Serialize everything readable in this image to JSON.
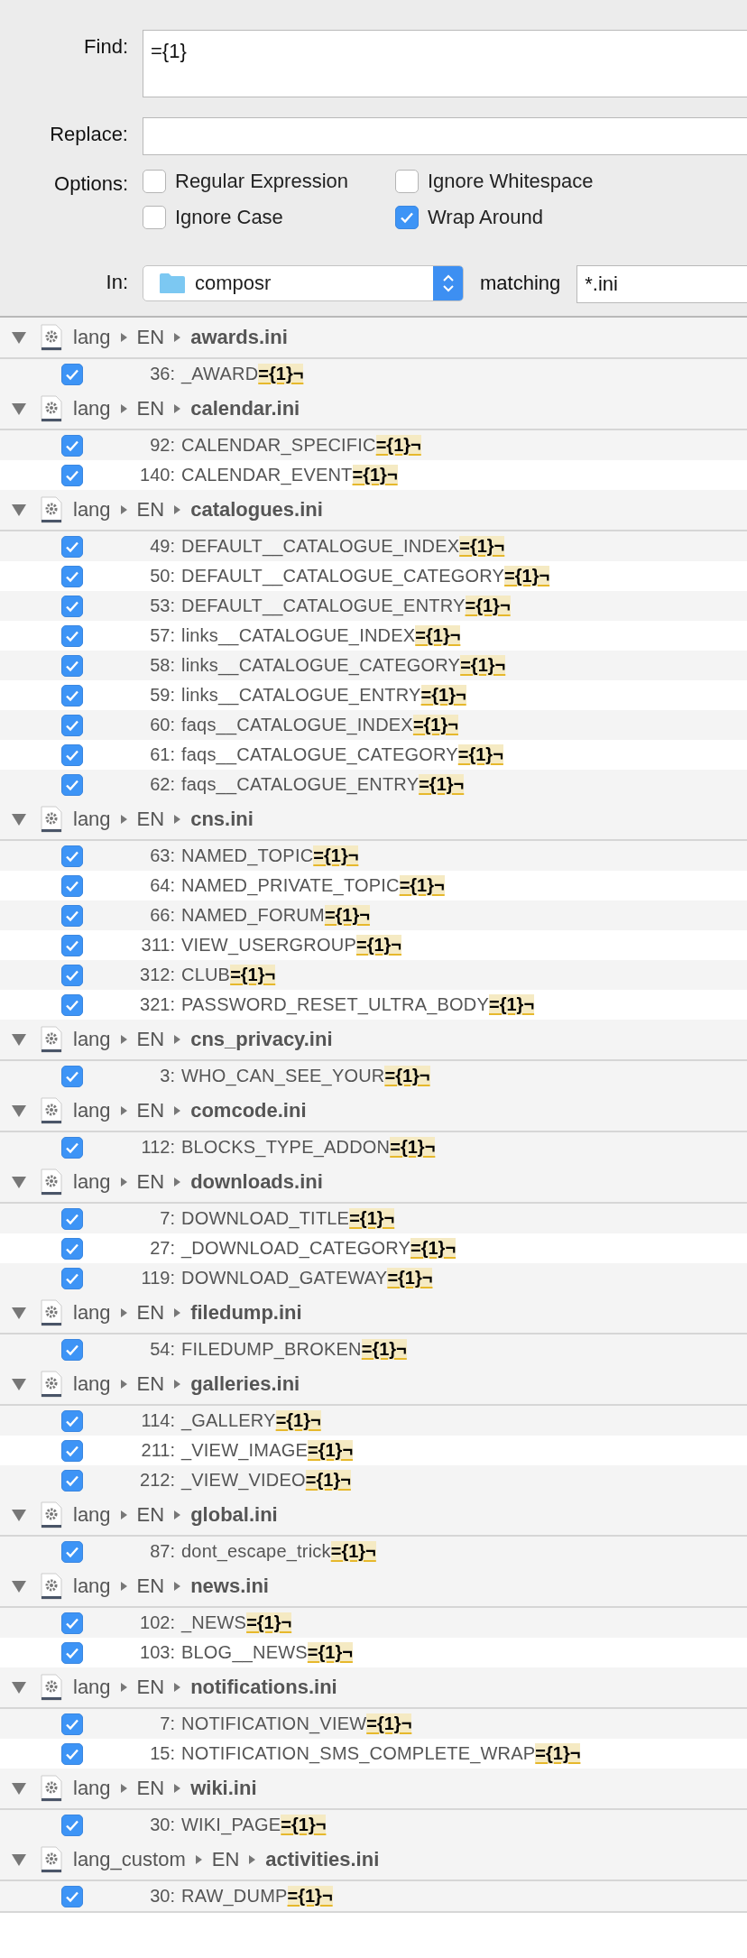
{
  "find": {
    "label": "Find:",
    "value": "={1}"
  },
  "replace": {
    "label": "Replace:"
  },
  "options": {
    "label": "Options:",
    "items": [
      {
        "label": "Regular Expression",
        "checked": false
      },
      {
        "label": "Ignore Whitespace",
        "checked": false
      },
      {
        "label": "Ignore Case",
        "checked": false
      },
      {
        "label": "Wrap Around",
        "checked": true
      }
    ]
  },
  "scope": {
    "label": "In:",
    "folder": "composr",
    "matching_label": "matching",
    "matching": "*.ini"
  },
  "results": [
    {
      "path": [
        "lang",
        "EN"
      ],
      "file": "awards.ini",
      "expanded": true,
      "matches": [
        {
          "line": "36:",
          "text": "_AWARD",
          "match": "={1}¬",
          "checked": true
        }
      ]
    },
    {
      "path": [
        "lang",
        "EN"
      ],
      "file": "calendar.ini",
      "expanded": true,
      "matches": [
        {
          "line": "92:",
          "text": "CALENDAR_SPECIFIC",
          "match": "={1}¬",
          "checked": true
        },
        {
          "line": "140:",
          "text": "CALENDAR_EVENT",
          "match": "={1}¬",
          "checked": true
        }
      ]
    },
    {
      "path": [
        "lang",
        "EN"
      ],
      "file": "catalogues.ini",
      "expanded": true,
      "matches": [
        {
          "line": "49:",
          "text": "DEFAULT__CATALOGUE_INDEX",
          "match": "={1}¬",
          "checked": true
        },
        {
          "line": "50:",
          "text": "DEFAULT__CATALOGUE_CATEGORY",
          "match": "={1}¬",
          "checked": true
        },
        {
          "line": "53:",
          "text": "DEFAULT__CATALOGUE_ENTRY",
          "match": "={1}¬",
          "checked": true
        },
        {
          "line": "57:",
          "text": "links__CATALOGUE_INDEX",
          "match": "={1}¬",
          "checked": true
        },
        {
          "line": "58:",
          "text": "links__CATALOGUE_CATEGORY",
          "match": "={1}¬",
          "checked": true
        },
        {
          "line": "59:",
          "text": "links__CATALOGUE_ENTRY",
          "match": "={1}¬",
          "checked": true
        },
        {
          "line": "60:",
          "text": "faqs__CATALOGUE_INDEX",
          "match": "={1}¬",
          "checked": true
        },
        {
          "line": "61:",
          "text": "faqs__CATALOGUE_CATEGORY",
          "match": "={1}¬",
          "checked": true
        },
        {
          "line": "62:",
          "text": "faqs__CATALOGUE_ENTRY",
          "match": "={1}¬",
          "checked": true
        }
      ]
    },
    {
      "path": [
        "lang",
        "EN"
      ],
      "file": "cns.ini",
      "expanded": true,
      "matches": [
        {
          "line": "63:",
          "text": "NAMED_TOPIC",
          "match": "={1}¬",
          "checked": true
        },
        {
          "line": "64:",
          "text": "NAMED_PRIVATE_TOPIC",
          "match": "={1}¬",
          "checked": true
        },
        {
          "line": "66:",
          "text": "NAMED_FORUM",
          "match": "={1}¬",
          "checked": true
        },
        {
          "line": "311:",
          "text": "VIEW_USERGROUP",
          "match": "={1}¬",
          "checked": true
        },
        {
          "line": "312:",
          "text": "CLUB",
          "match": "={1}¬",
          "checked": true
        },
        {
          "line": "321:",
          "text": "PASSWORD_RESET_ULTRA_BODY",
          "match": "={1}¬",
          "checked": true
        }
      ]
    },
    {
      "path": [
        "lang",
        "EN"
      ],
      "file": "cns_privacy.ini",
      "expanded": true,
      "matches": [
        {
          "line": "3:",
          "text": "WHO_CAN_SEE_YOUR",
          "match": "={1}¬",
          "checked": true
        }
      ]
    },
    {
      "path": [
        "lang",
        "EN"
      ],
      "file": "comcode.ini",
      "expanded": true,
      "matches": [
        {
          "line": "112:",
          "text": "BLOCKS_TYPE_ADDON",
          "match": "={1}¬",
          "checked": true
        }
      ]
    },
    {
      "path": [
        "lang",
        "EN"
      ],
      "file": "downloads.ini",
      "expanded": true,
      "matches": [
        {
          "line": "7:",
          "text": "DOWNLOAD_TITLE",
          "match": "={1}¬",
          "checked": true
        },
        {
          "line": "27:",
          "text": "_DOWNLOAD_CATEGORY",
          "match": "={1}¬",
          "checked": true
        },
        {
          "line": "119:",
          "text": "DOWNLOAD_GATEWAY",
          "match": "={1}¬",
          "checked": true
        }
      ]
    },
    {
      "path": [
        "lang",
        "EN"
      ],
      "file": "filedump.ini",
      "expanded": true,
      "matches": [
        {
          "line": "54:",
          "text": "FILEDUMP_BROKEN",
          "match": "={1}¬",
          "checked": true
        }
      ]
    },
    {
      "path": [
        "lang",
        "EN"
      ],
      "file": "galleries.ini",
      "expanded": true,
      "matches": [
        {
          "line": "114:",
          "text": "_GALLERY",
          "match": "={1}¬",
          "checked": true
        },
        {
          "line": "211:",
          "text": "_VIEW_IMAGE",
          "match": "={1}¬",
          "checked": true
        },
        {
          "line": "212:",
          "text": "_VIEW_VIDEO",
          "match": "={1}¬",
          "checked": true
        }
      ]
    },
    {
      "path": [
        "lang",
        "EN"
      ],
      "file": "global.ini",
      "expanded": true,
      "matches": [
        {
          "line": "87:",
          "text": "dont_escape_trick",
          "match": "={1}¬",
          "checked": true
        }
      ]
    },
    {
      "path": [
        "lang",
        "EN"
      ],
      "file": "news.ini",
      "expanded": true,
      "matches": [
        {
          "line": "102:",
          "text": "_NEWS",
          "match": "={1}¬",
          "checked": true
        },
        {
          "line": "103:",
          "text": "BLOG__NEWS",
          "match": "={1}¬",
          "checked": true
        }
      ]
    },
    {
      "path": [
        "lang",
        "EN"
      ],
      "file": "notifications.ini",
      "expanded": true,
      "matches": [
        {
          "line": "7:",
          "text": "NOTIFICATION_VIEW",
          "match": "={1}¬",
          "checked": true
        },
        {
          "line": "15:",
          "text": "NOTIFICATION_SMS_COMPLETE_WRAP",
          "match": "={1}¬",
          "checked": true
        }
      ]
    },
    {
      "path": [
        "lang",
        "EN"
      ],
      "file": "wiki.ini",
      "expanded": true,
      "matches": [
        {
          "line": "30:",
          "text": "WIKI_PAGE",
          "match": "={1}¬",
          "checked": true
        }
      ]
    },
    {
      "path": [
        "lang_custom",
        "EN"
      ],
      "file": "activities.ini",
      "expanded": true,
      "matches": [
        {
          "line": "30:",
          "text": "RAW_DUMP",
          "match": "={1}¬",
          "checked": true
        }
      ]
    }
  ]
}
